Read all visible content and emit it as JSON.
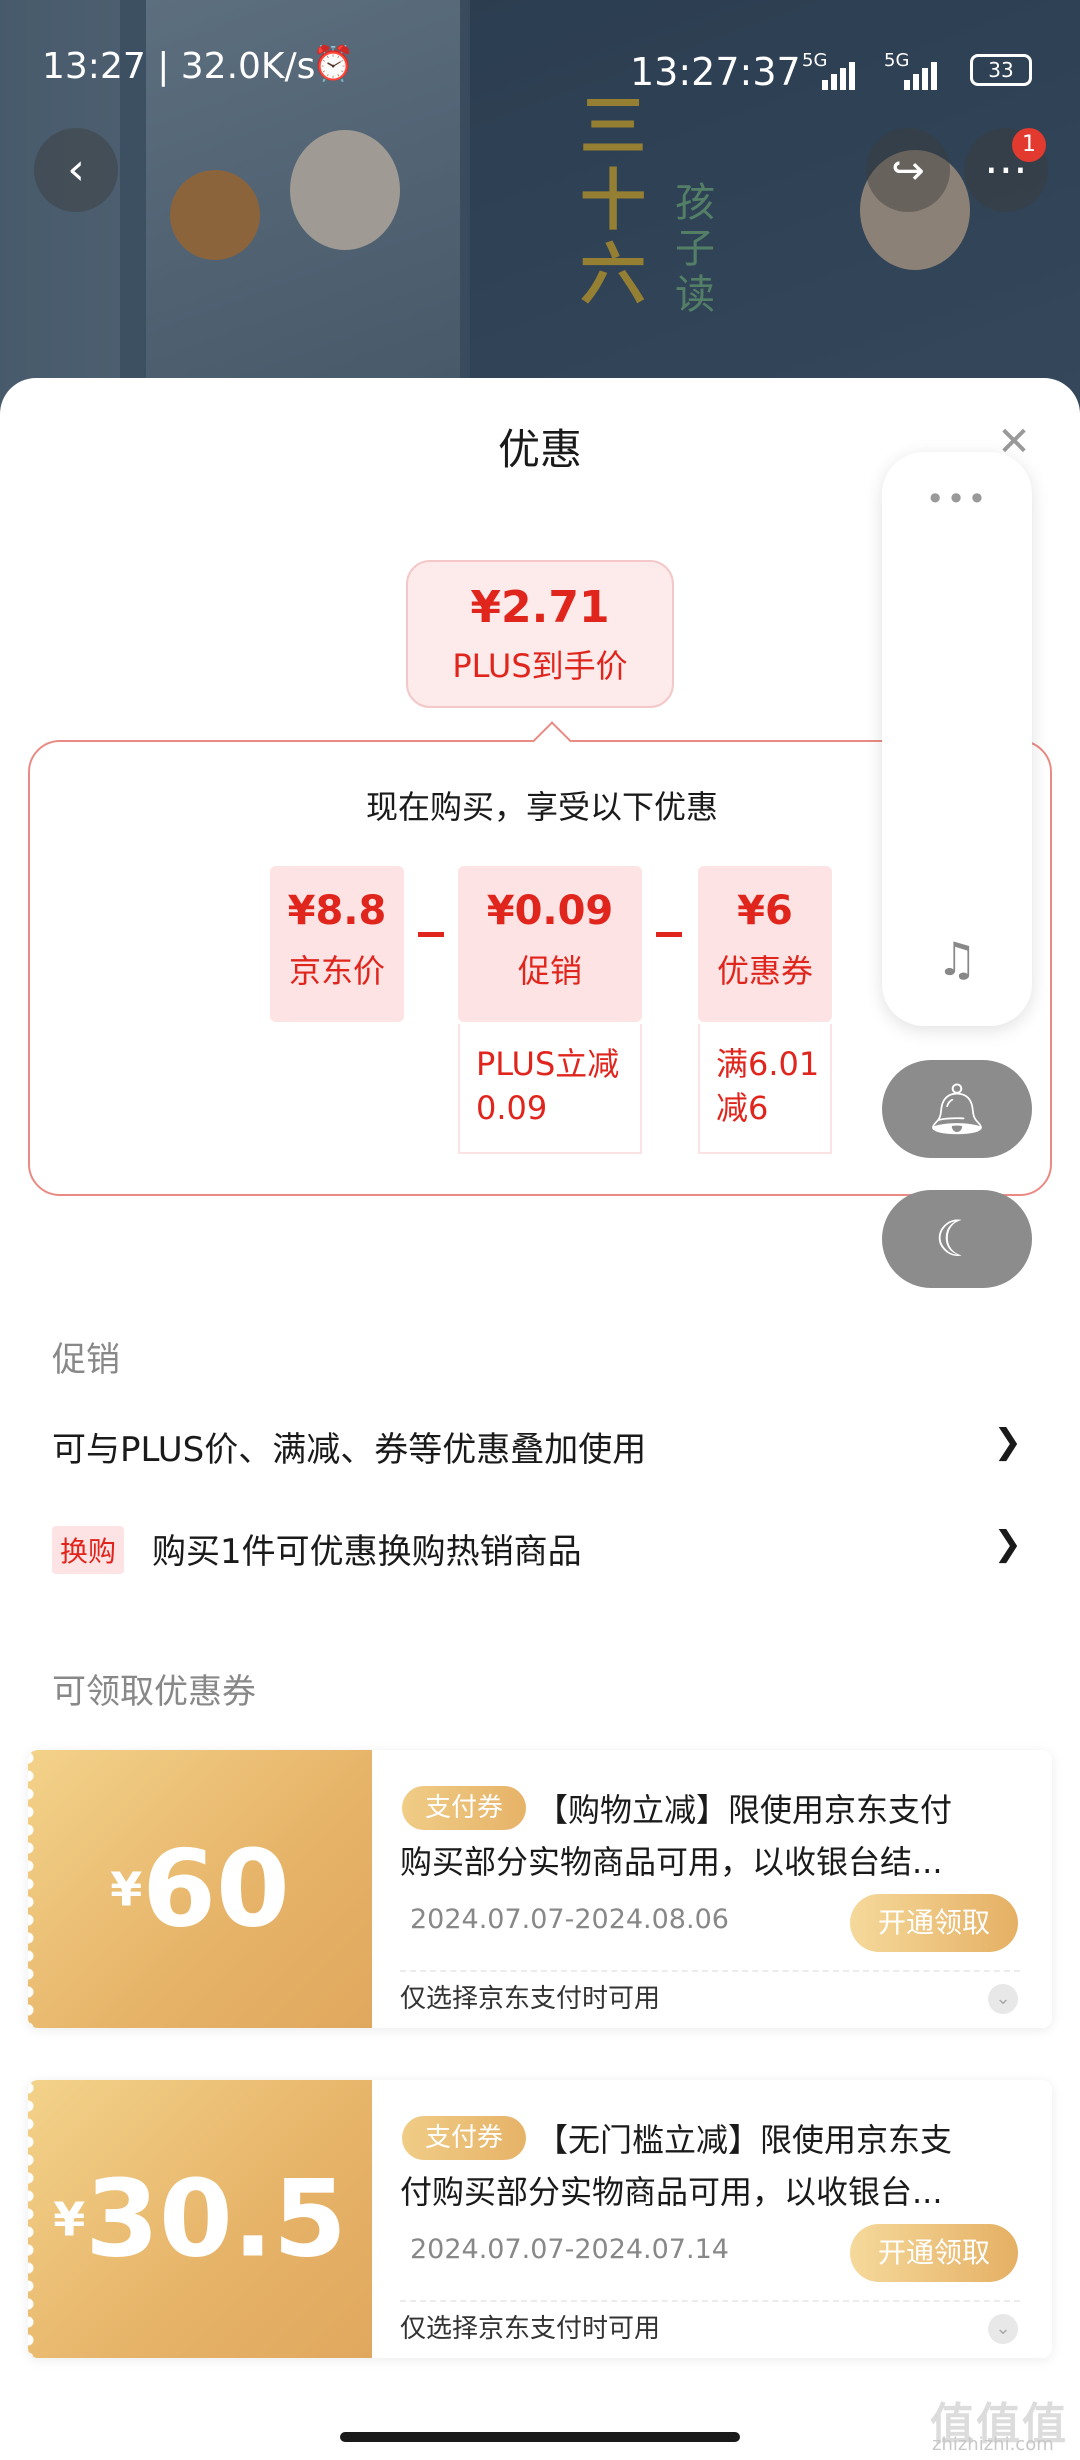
{
  "status_bar": {
    "time_speed": "13:27 | 32.0K/s",
    "alarm_icon": "alarm-icon",
    "clock": "13:27:37",
    "network1": "5G",
    "network2": "5G",
    "battery": "33"
  },
  "nav": {
    "back_icon": "chevron-left-icon",
    "share_icon": "share-icon",
    "more_icon": "more-dots-icon",
    "badge": "1"
  },
  "sheet": {
    "title": "优惠",
    "close_icon": "close-icon"
  },
  "plus_price": {
    "value": "¥2.71",
    "label": "PLUS到手价"
  },
  "breakdown": {
    "headline": "现在购买，享受以下优惠",
    "items": [
      {
        "value": "¥8.8",
        "label": "京东价",
        "detail": ""
      },
      {
        "value": "¥0.09",
        "label": "促销",
        "detail_line1": "PLUS立减",
        "detail_line2": "0.09"
      },
      {
        "value": "¥6",
        "label": "优惠券",
        "detail_line1": "满6.01",
        "detail_line2": "减6"
      }
    ]
  },
  "side_panel": {
    "more_icon": "more-dots-icon",
    "music_icon": "music-note-icon",
    "bell_icon": "bell-icon",
    "moon_icon": "moon-icon"
  },
  "promotions": {
    "section_label": "促销",
    "rows": [
      {
        "text": "可与PLUS价、满减、券等优惠叠加使用"
      },
      {
        "tag": "换购",
        "text": "购买1件可优惠换购热销商品"
      }
    ]
  },
  "coupons": {
    "section_label": "可领取优惠券",
    "items": [
      {
        "currency": "¥",
        "amount": "60",
        "tag": "支付券",
        "title": "【购物立减】限使用京东支付",
        "desc": "购买部分实物商品可用，以收银台结...",
        "date": "2024.07.07-2024.08.06",
        "claim": "开通领取",
        "note": "仅选择京东支付时可用"
      },
      {
        "currency": "¥",
        "amount": "30.5",
        "tag": "支付券",
        "title": "【无门槛立减】限使用京东支",
        "desc": "付购买部分实物商品可用，以收银台...",
        "date": "2024.07.07-2024.07.14",
        "claim": "开通领取",
        "note": "仅选择京东支付时可用"
      }
    ]
  },
  "watermark": {
    "text": "值值值",
    "sub": "zhizhizhi.com"
  }
}
